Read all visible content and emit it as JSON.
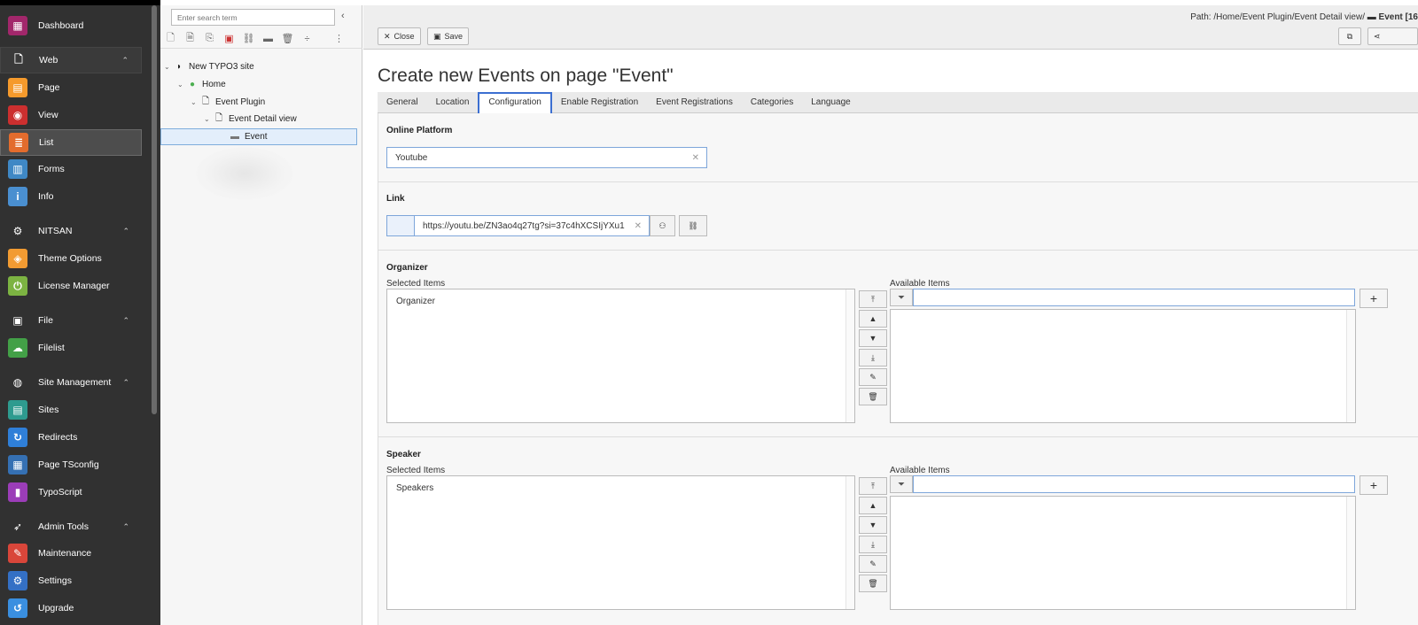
{
  "modules": [
    {
      "key": "dashboard",
      "label": "Dashboard",
      "color": "#a2276b",
      "glyph": "▦",
      "icon": "dashboard-icon",
      "type": "item"
    },
    {
      "key": "web",
      "label": "Web",
      "icon": "document-icon",
      "glyph": "🗋",
      "type": "group"
    },
    {
      "key": "page",
      "label": "Page",
      "color": "#f59a2c",
      "glyph": "▤",
      "icon": "page-icon",
      "type": "item"
    },
    {
      "key": "view",
      "label": "View",
      "color": "#cc2f2f",
      "glyph": "◉",
      "icon": "eye-icon",
      "type": "item"
    },
    {
      "key": "list",
      "label": "List",
      "color": "#e36c2d",
      "glyph": "≣",
      "icon": "list-icon",
      "type": "item",
      "active": true
    },
    {
      "key": "forms",
      "label": "Forms",
      "color": "#3f88c5",
      "glyph": "▥",
      "icon": "forms-icon",
      "type": "item"
    },
    {
      "key": "info",
      "label": "Info",
      "color": "#4a8fd0",
      "glyph": "i",
      "icon": "info-icon",
      "type": "item"
    },
    {
      "key": "nitsan",
      "label": "NITSAN",
      "icon": "gear-icon",
      "glyph": "⚙",
      "type": "group"
    },
    {
      "key": "theme",
      "label": "Theme Options",
      "color": "#f29b32",
      "glyph": "◈",
      "icon": "theme-icon",
      "type": "item"
    },
    {
      "key": "license",
      "label": "License Manager",
      "color": "#7cb342",
      "glyph": "⏻",
      "icon": "license-icon",
      "type": "item"
    },
    {
      "key": "file",
      "label": "File",
      "icon": "image-icon",
      "glyph": "▣",
      "type": "group"
    },
    {
      "key": "filelist",
      "label": "Filelist",
      "color": "#43a047",
      "glyph": "☁",
      "icon": "cloud-icon",
      "type": "item"
    },
    {
      "key": "site",
      "label": "Site Management",
      "icon": "globe-icon",
      "glyph": "◍",
      "type": "group"
    },
    {
      "key": "sites",
      "label": "Sites",
      "color": "#2e9b8f",
      "glyph": "▤",
      "icon": "sites-icon",
      "type": "item"
    },
    {
      "key": "redirects",
      "label": "Redirects",
      "color": "#2f7fd8",
      "glyph": "↻",
      "icon": "redirect-icon",
      "type": "item"
    },
    {
      "key": "tsconfig",
      "label": "Page TSconfig",
      "color": "#3570b3",
      "glyph": "▦",
      "icon": "tsconfig-icon",
      "type": "item"
    },
    {
      "key": "typoscript",
      "label": "TypoScript",
      "color": "#9b3db8",
      "glyph": "▮",
      "icon": "typoscript-icon",
      "type": "item"
    },
    {
      "key": "admin",
      "label": "Admin Tools",
      "icon": "rocket-icon",
      "glyph": "➶",
      "type": "group"
    },
    {
      "key": "maintenance",
      "label": "Maintenance",
      "color": "#d9463a",
      "glyph": "✎",
      "icon": "wrench-icon",
      "type": "item"
    },
    {
      "key": "settings",
      "label": "Settings",
      "color": "#3470c5",
      "glyph": "⚙",
      "icon": "settings-icon",
      "type": "item"
    },
    {
      "key": "upgrade",
      "label": "Upgrade",
      "color": "#3a8fe0",
      "glyph": "↺",
      "icon": "upgrade-icon",
      "type": "item"
    }
  ],
  "tree": {
    "search_placeholder": "Enter search term",
    "nodes": [
      {
        "label": "New TYPO3 site",
        "indent": 0,
        "toggle": "⌄",
        "glyph": "◗",
        "icon": "typo3-site-icon"
      },
      {
        "label": "Home",
        "indent": 1,
        "toggle": "⌄",
        "glyph": "●",
        "icon": "home-globe-icon"
      },
      {
        "label": "Event Plugin",
        "indent": 2,
        "toggle": "⌄",
        "glyph": "🗋",
        "icon": "page-document-icon"
      },
      {
        "label": "Event Detail view",
        "indent": 3,
        "toggle": "⌄",
        "glyph": "🗋",
        "icon": "page-document-icon"
      },
      {
        "label": "Event",
        "indent": 4,
        "toggle": "",
        "glyph": "▬",
        "icon": "folder-icon",
        "selected": true
      }
    ]
  },
  "docheader": {
    "close_label": "Close",
    "save_label": "Save",
    "path_prefix": "Path: /Home/Event Plugin/Event Detail view/",
    "path_current": "Event [16"
  },
  "title": "Create new Events on page \"Event\"",
  "tabs": [
    "General",
    "Location",
    "Configuration",
    "Enable Registration",
    "Event Registrations",
    "Categories",
    "Language"
  ],
  "active_tab": "Configuration",
  "form": {
    "online_platform": {
      "label": "Online Platform",
      "value": "Youtube"
    },
    "link": {
      "label": "Link",
      "value": "https://youtu.be/ZN3ao4q27tg?si=37c4hXCSIjYXu1"
    },
    "organizer": {
      "label": "Organizer",
      "selected_label": "Selected Items",
      "available_label": "Available Items",
      "selected": [
        "Organizer"
      ]
    },
    "speaker": {
      "label": "Speaker",
      "selected_label": "Selected Items",
      "available_label": "Available Items",
      "selected": [
        "Speakers"
      ]
    }
  }
}
